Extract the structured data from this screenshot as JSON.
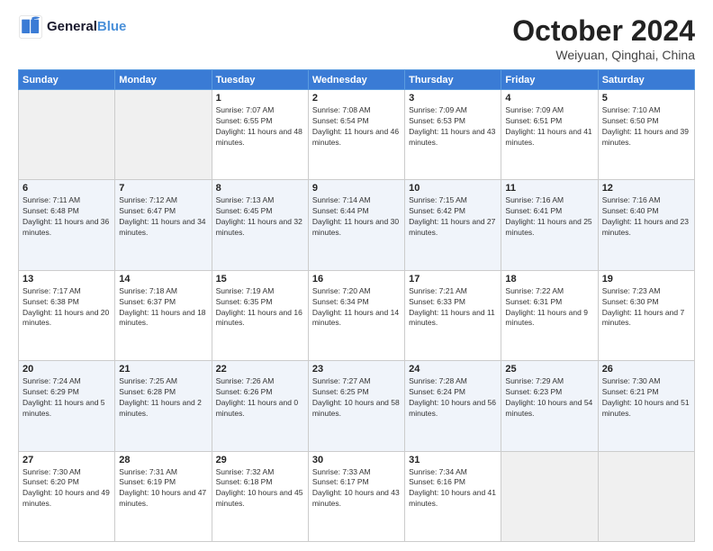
{
  "logo": {
    "line1": "General",
    "line2": "Blue"
  },
  "title": "October 2024",
  "location": "Weiyuan, Qinghai, China",
  "weekdays": [
    "Sunday",
    "Monday",
    "Tuesday",
    "Wednesday",
    "Thursday",
    "Friday",
    "Saturday"
  ],
  "weeks": [
    [
      {
        "day": "",
        "info": ""
      },
      {
        "day": "",
        "info": ""
      },
      {
        "day": "1",
        "info": "Sunrise: 7:07 AM\nSunset: 6:55 PM\nDaylight: 11 hours and 48 minutes."
      },
      {
        "day": "2",
        "info": "Sunrise: 7:08 AM\nSunset: 6:54 PM\nDaylight: 11 hours and 46 minutes."
      },
      {
        "day": "3",
        "info": "Sunrise: 7:09 AM\nSunset: 6:53 PM\nDaylight: 11 hours and 43 minutes."
      },
      {
        "day": "4",
        "info": "Sunrise: 7:09 AM\nSunset: 6:51 PM\nDaylight: 11 hours and 41 minutes."
      },
      {
        "day": "5",
        "info": "Sunrise: 7:10 AM\nSunset: 6:50 PM\nDaylight: 11 hours and 39 minutes."
      }
    ],
    [
      {
        "day": "6",
        "info": "Sunrise: 7:11 AM\nSunset: 6:48 PM\nDaylight: 11 hours and 36 minutes."
      },
      {
        "day": "7",
        "info": "Sunrise: 7:12 AM\nSunset: 6:47 PM\nDaylight: 11 hours and 34 minutes."
      },
      {
        "day": "8",
        "info": "Sunrise: 7:13 AM\nSunset: 6:45 PM\nDaylight: 11 hours and 32 minutes."
      },
      {
        "day": "9",
        "info": "Sunrise: 7:14 AM\nSunset: 6:44 PM\nDaylight: 11 hours and 30 minutes."
      },
      {
        "day": "10",
        "info": "Sunrise: 7:15 AM\nSunset: 6:42 PM\nDaylight: 11 hours and 27 minutes."
      },
      {
        "day": "11",
        "info": "Sunrise: 7:16 AM\nSunset: 6:41 PM\nDaylight: 11 hours and 25 minutes."
      },
      {
        "day": "12",
        "info": "Sunrise: 7:16 AM\nSunset: 6:40 PM\nDaylight: 11 hours and 23 minutes."
      }
    ],
    [
      {
        "day": "13",
        "info": "Sunrise: 7:17 AM\nSunset: 6:38 PM\nDaylight: 11 hours and 20 minutes."
      },
      {
        "day": "14",
        "info": "Sunrise: 7:18 AM\nSunset: 6:37 PM\nDaylight: 11 hours and 18 minutes."
      },
      {
        "day": "15",
        "info": "Sunrise: 7:19 AM\nSunset: 6:35 PM\nDaylight: 11 hours and 16 minutes."
      },
      {
        "day": "16",
        "info": "Sunrise: 7:20 AM\nSunset: 6:34 PM\nDaylight: 11 hours and 14 minutes."
      },
      {
        "day": "17",
        "info": "Sunrise: 7:21 AM\nSunset: 6:33 PM\nDaylight: 11 hours and 11 minutes."
      },
      {
        "day": "18",
        "info": "Sunrise: 7:22 AM\nSunset: 6:31 PM\nDaylight: 11 hours and 9 minutes."
      },
      {
        "day": "19",
        "info": "Sunrise: 7:23 AM\nSunset: 6:30 PM\nDaylight: 11 hours and 7 minutes."
      }
    ],
    [
      {
        "day": "20",
        "info": "Sunrise: 7:24 AM\nSunset: 6:29 PM\nDaylight: 11 hours and 5 minutes."
      },
      {
        "day": "21",
        "info": "Sunrise: 7:25 AM\nSunset: 6:28 PM\nDaylight: 11 hours and 2 minutes."
      },
      {
        "day": "22",
        "info": "Sunrise: 7:26 AM\nSunset: 6:26 PM\nDaylight: 11 hours and 0 minutes."
      },
      {
        "day": "23",
        "info": "Sunrise: 7:27 AM\nSunset: 6:25 PM\nDaylight: 10 hours and 58 minutes."
      },
      {
        "day": "24",
        "info": "Sunrise: 7:28 AM\nSunset: 6:24 PM\nDaylight: 10 hours and 56 minutes."
      },
      {
        "day": "25",
        "info": "Sunrise: 7:29 AM\nSunset: 6:23 PM\nDaylight: 10 hours and 54 minutes."
      },
      {
        "day": "26",
        "info": "Sunrise: 7:30 AM\nSunset: 6:21 PM\nDaylight: 10 hours and 51 minutes."
      }
    ],
    [
      {
        "day": "27",
        "info": "Sunrise: 7:30 AM\nSunset: 6:20 PM\nDaylight: 10 hours and 49 minutes."
      },
      {
        "day": "28",
        "info": "Sunrise: 7:31 AM\nSunset: 6:19 PM\nDaylight: 10 hours and 47 minutes."
      },
      {
        "day": "29",
        "info": "Sunrise: 7:32 AM\nSunset: 6:18 PM\nDaylight: 10 hours and 45 minutes."
      },
      {
        "day": "30",
        "info": "Sunrise: 7:33 AM\nSunset: 6:17 PM\nDaylight: 10 hours and 43 minutes."
      },
      {
        "day": "31",
        "info": "Sunrise: 7:34 AM\nSunset: 6:16 PM\nDaylight: 10 hours and 41 minutes."
      },
      {
        "day": "",
        "info": ""
      },
      {
        "day": "",
        "info": ""
      }
    ]
  ]
}
